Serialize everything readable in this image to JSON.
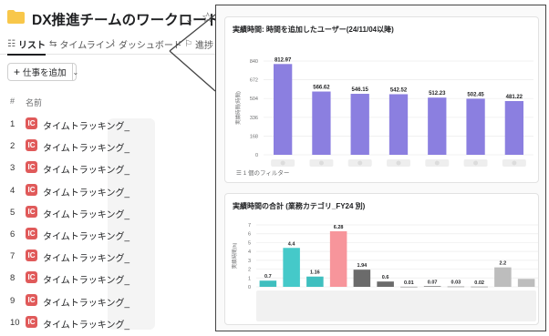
{
  "header": {
    "title": "DX推進チームのワークロード",
    "caret": "⌄",
    "star": "☆",
    "folder_color": "#f8c74a"
  },
  "tabs": [
    {
      "icon": "☷",
      "label": "リスト",
      "active": true
    },
    {
      "icon": "⇆",
      "label": "タイムライン",
      "active": false
    },
    {
      "icon": "⌇",
      "label": "ダッシュボード",
      "active": false
    },
    {
      "icon": "⚐",
      "label": "進捗",
      "active": false
    }
  ],
  "toolbar": {
    "add_plus": "+",
    "add_label": "仕事を追加",
    "dropdown": "⌄"
  },
  "list": {
    "col_number": "#",
    "col_name": "名前",
    "rows": [
      {
        "num": "1",
        "name": "タイムトラッキング_",
        "badge": "IC"
      },
      {
        "num": "2",
        "name": "タイムトラッキング_",
        "badge": "IC"
      },
      {
        "num": "3",
        "name": "タイムトラッキング_",
        "badge": "IC"
      },
      {
        "num": "4",
        "name": "タイムトラッキング_",
        "badge": "IC"
      },
      {
        "num": "5",
        "name": "タイムトラッキング_",
        "badge": "IC"
      },
      {
        "num": "6",
        "name": "タイムトラッキング_",
        "badge": "IC"
      },
      {
        "num": "7",
        "name": "タイムトラッキング_",
        "badge": "IC"
      },
      {
        "num": "8",
        "name": "タイムトラッキング_",
        "badge": "IC"
      },
      {
        "num": "9",
        "name": "タイムトラッキング_",
        "badge": "IC"
      },
      {
        "num": "10",
        "name": "タイムトラッキング_",
        "badge": "IC"
      }
    ]
  },
  "colors": {
    "accent_red": "#e05a5a",
    "bar_purple": "#8b7fe0",
    "panel_border": "#444444"
  },
  "chart_data": [
    {
      "type": "bar",
      "title": "実績時間: 時間を追加したユーザー(24/11/04以降)",
      "ylabel": "実績時間(時間)",
      "ylim": [
        0,
        840
      ],
      "yticks": [
        0,
        168,
        336,
        504,
        672,
        840
      ],
      "categories": [
        "",
        "",
        "",
        "",
        "",
        "",
        ""
      ],
      "values": [
        812.97,
        566.62,
        546.15,
        542.52,
        512.23,
        502.45,
        481.22
      ],
      "value_labels": [
        "812.97",
        "566.62",
        "546.15",
        "542.52",
        "512.23",
        "502.45",
        "481.22"
      ],
      "color": "#8b7fe0",
      "filter_label": "1 個のフィルター"
    },
    {
      "type": "bar",
      "title": "実績時間の合計 (業務カテゴリ_FY24 別)",
      "ylabel": "実績時間(h)",
      "ylim": [
        0,
        7
      ],
      "yticks": [
        0,
        1,
        2,
        3,
        4,
        5,
        6,
        7
      ],
      "values": [
        0.7,
        4.4,
        1.16,
        6.28,
        1.94,
        0.6,
        0.01,
        0.07,
        0.03,
        0.02,
        2.2,
        0.9
      ],
      "value_labels": [
        "0.7",
        "4.4",
        "1.16",
        "6.28",
        "1.94",
        "0.6",
        "0.01",
        "0.07",
        "0.03",
        "0.02",
        "2.2",
        ""
      ],
      "colors": [
        "#3fbfbf",
        "#45c9c9",
        "#3fbfbf",
        "#f7959b",
        "#6b6b6b",
        "#6b6b6b",
        "#6b6b6b",
        "#6b6b6b",
        "#6b6b6b",
        "#6b6b6b",
        "#bdbdbd",
        "#bdbdbd"
      ]
    }
  ]
}
